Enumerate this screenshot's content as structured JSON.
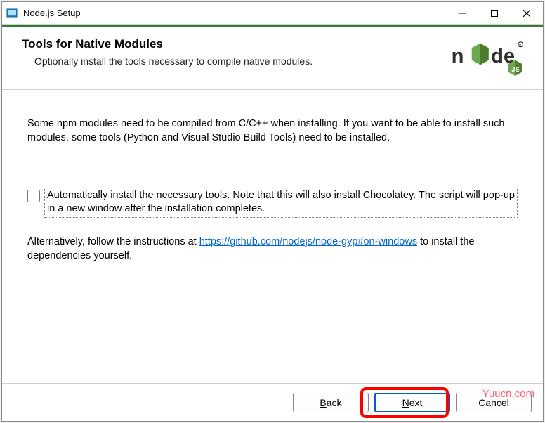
{
  "titlebar": {
    "title": "Node.js Setup"
  },
  "header": {
    "heading": "Tools for Native Modules",
    "subheading": "Optionally install the tools necessary to compile native modules."
  },
  "content": {
    "intro": "Some npm modules need to be compiled from C/C++ when installing. If you want to be able to install such modules, some tools (Python and Visual Studio Build Tools) need to be installed.",
    "checkbox_label": "Automatically install the necessary tools. Note that this will also install Chocolatey. The script will pop-up in a new window after the installation completes.",
    "alt_prefix": "Alternatively, follow the instructions at ",
    "alt_link_text": "https://github.com/nodejs/node-gyp#on-windows",
    "alt_link_href": "https://github.com/nodejs/node-gyp#on-windows",
    "alt_suffix": " to install the dependencies yourself."
  },
  "footer": {
    "back_prefix": "B",
    "back_rest": "ack",
    "next_prefix": "N",
    "next_rest": "ext",
    "cancel": "Cancel"
  },
  "watermark": "Yuucn.com"
}
